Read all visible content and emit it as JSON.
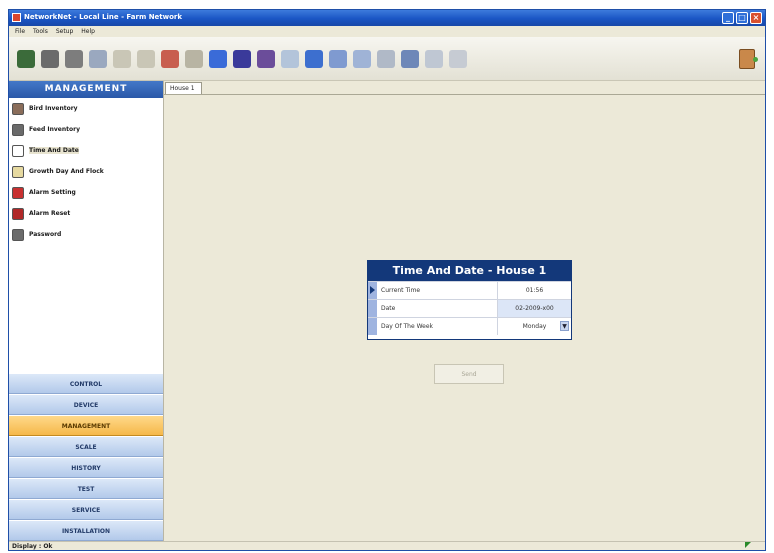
{
  "window": {
    "title": "NetworkNet - Local Line - Farm Network"
  },
  "menu": [
    "File",
    "Tools",
    "Setup",
    "Help"
  ],
  "sidebar": {
    "header": "MANAGEMENT",
    "items": [
      {
        "label": "Bird Inventory",
        "icon": "bird-icon",
        "color": "#8a6d5a"
      },
      {
        "label": "Feed Inventory",
        "icon": "silo-icon",
        "color": "#6a6a6a"
      },
      {
        "label": "Time And Date",
        "icon": "clock-icon",
        "color": "#ffffff",
        "selected": true
      },
      {
        "label": "Growth Day And Flock",
        "icon": "calendar-icon",
        "color": "#e6d9a0"
      },
      {
        "label": "Alarm Setting",
        "icon": "alarm-icon",
        "color": "#c83030"
      },
      {
        "label": "Alarm Reset",
        "icon": "alarm-reset-icon",
        "color": "#b02828"
      },
      {
        "label": "Password",
        "icon": "lock-icon",
        "color": "#6b6b6b"
      }
    ]
  },
  "nav": [
    {
      "label": "CONTROL"
    },
    {
      "label": "DEVICE"
    },
    {
      "label": "MANAGEMENT",
      "active": true
    },
    {
      "label": "SCALE"
    },
    {
      "label": "HISTORY"
    },
    {
      "label": "TEST"
    },
    {
      "label": "SERVICE"
    },
    {
      "label": "INSTALLATION"
    }
  ],
  "tabs": [
    "House 1"
  ],
  "panel": {
    "title": "Time And Date - House 1",
    "rows": [
      {
        "label": "Current Time",
        "value": "01:56"
      },
      {
        "label": "Date",
        "value": "02-2009-x00"
      },
      {
        "label": "Day Of The Week",
        "value": "Monday"
      }
    ]
  },
  "send_label": "Send",
  "status": "Display : Ok",
  "colors": {
    "accent": "#13387a",
    "nav_active": "#f5b84a",
    "title_bar": "#1a55c4"
  },
  "toolbar_icons": [
    {
      "name": "monitor-icon",
      "color": "#3b6b3a"
    },
    {
      "name": "tools-icon",
      "color": "#6b6b6b"
    },
    {
      "name": "grid-icon",
      "color": "#7d7d7d"
    },
    {
      "name": "device-icon",
      "color": "#9aa8bf"
    },
    {
      "name": "flask-icon",
      "color": "#c9c6b6"
    },
    {
      "name": "pen-icon",
      "color": "#c9c6b6"
    },
    {
      "name": "feed-icon",
      "color": "#c85e4f"
    },
    {
      "name": "user-icon",
      "color": "#b8b4a3"
    },
    {
      "name": "chart-icon",
      "color": "#3a6bd8"
    },
    {
      "name": "bar-chart-icon",
      "color": "#3a3a9a"
    },
    {
      "name": "gauge-icon",
      "color": "#6b4d9a"
    },
    {
      "name": "ring-icon",
      "color": "#b3c4da"
    },
    {
      "name": "phone-icon",
      "color": "#3d6fcf"
    },
    {
      "name": "calendar-icon",
      "color": "#7f9ad0"
    },
    {
      "name": "scale-icon",
      "color": "#9fb3d6"
    },
    {
      "name": "printer-icon",
      "color": "#b0b9c7"
    },
    {
      "name": "network-icon",
      "color": "#6e87b8"
    },
    {
      "name": "lamp-icon",
      "color": "#bfc7d3"
    },
    {
      "name": "disk-icon",
      "color": "#c6cbd3"
    }
  ]
}
